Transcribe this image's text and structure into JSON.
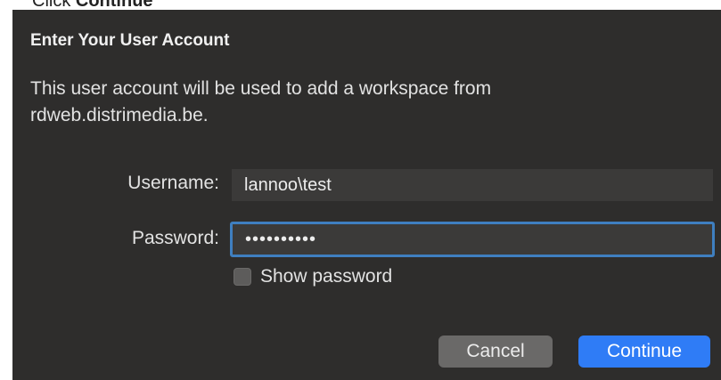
{
  "instruction": {
    "prefix": "Click ",
    "action": "Continue"
  },
  "dialog": {
    "title": "Enter Your User Account",
    "description": "This user account will be used to add a workspace from rdweb.distrimedia.be.",
    "username_label": "Username:",
    "username_value": "lannoo\\test",
    "password_label": "Password:",
    "password_value": "••••••••••",
    "show_password_label": "Show password",
    "show_password_checked": false,
    "cancel_label": "Cancel",
    "continue_label": "Continue"
  },
  "colors": {
    "dialog_bg": "#2e2d2c",
    "field_bg": "#3b3a39",
    "focus_ring": "#3f7fc0",
    "primary_button": "#2f7cf6",
    "secondary_button": "#6a6968"
  }
}
